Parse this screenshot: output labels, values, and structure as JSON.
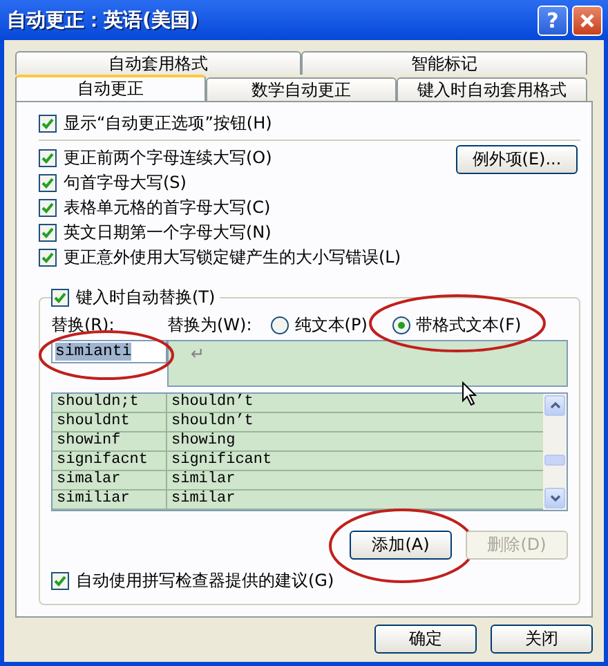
{
  "window": {
    "title": "自动更正：英语(美国)",
    "help": "?"
  },
  "tab_rows": [
    {
      "tabs": [
        {
          "label": "自动套用格式",
          "selected": false
        },
        {
          "label": "智能标记",
          "selected": false
        }
      ]
    },
    {
      "tabs": [
        {
          "label": "自动更正",
          "selected": true
        },
        {
          "label": "数学自动更正",
          "selected": false
        },
        {
          "label": "键入时自动套用格式",
          "selected": false
        }
      ]
    }
  ],
  "show_options_button": {
    "label": "显示“自动更正选项”按钮(H)",
    "checked": true
  },
  "corrections": [
    {
      "label": "更正前两个字母连续大写(O)",
      "checked": true
    },
    {
      "label": "句首字母大写(S)",
      "checked": true
    },
    {
      "label": "表格单元格的首字母大写(C)",
      "checked": true
    },
    {
      "label": "英文日期第一个字母大写(N)",
      "checked": true
    },
    {
      "label": "更正意外使用大写锁定键产生的大小写错误(L)",
      "checked": true
    }
  ],
  "exceptions_button": {
    "label": "例外项(E)..."
  },
  "replace_group": {
    "checkbox": {
      "label": "键入时自动替换(T)",
      "checked": true
    },
    "replace_label": "替换(R):",
    "with_label": "替换为(W):",
    "radios": [
      {
        "label": "纯文本(P)",
        "selected": false
      },
      {
        "label": "带格式文本(F)",
        "selected": true,
        "circled": true
      }
    ],
    "replace_field": {
      "value": "simianti",
      "circled": true
    },
    "with_field": {
      "value": "↵"
    },
    "rows": [
      {
        "from": "shouldn;t",
        "to": "shouldn’t"
      },
      {
        "from": "shouldnt",
        "to": "shouldn’t"
      },
      {
        "from": "showinf",
        "to": "showing"
      },
      {
        "from": "signifacnt",
        "to": "significant"
      },
      {
        "from": "simalar",
        "to": "similar"
      },
      {
        "from": "similiar",
        "to": "similar"
      }
    ],
    "add_button": {
      "label": "添加(A)",
      "disabled": false,
      "circled": true
    },
    "delete_button": {
      "label": "删除(D)",
      "disabled": true
    },
    "spelling": {
      "label": "自动使用拼写检查器提供的建议(G)",
      "checked": true
    }
  },
  "footer_buttons": [
    {
      "label": "确定"
    },
    {
      "label": "关闭"
    }
  ]
}
